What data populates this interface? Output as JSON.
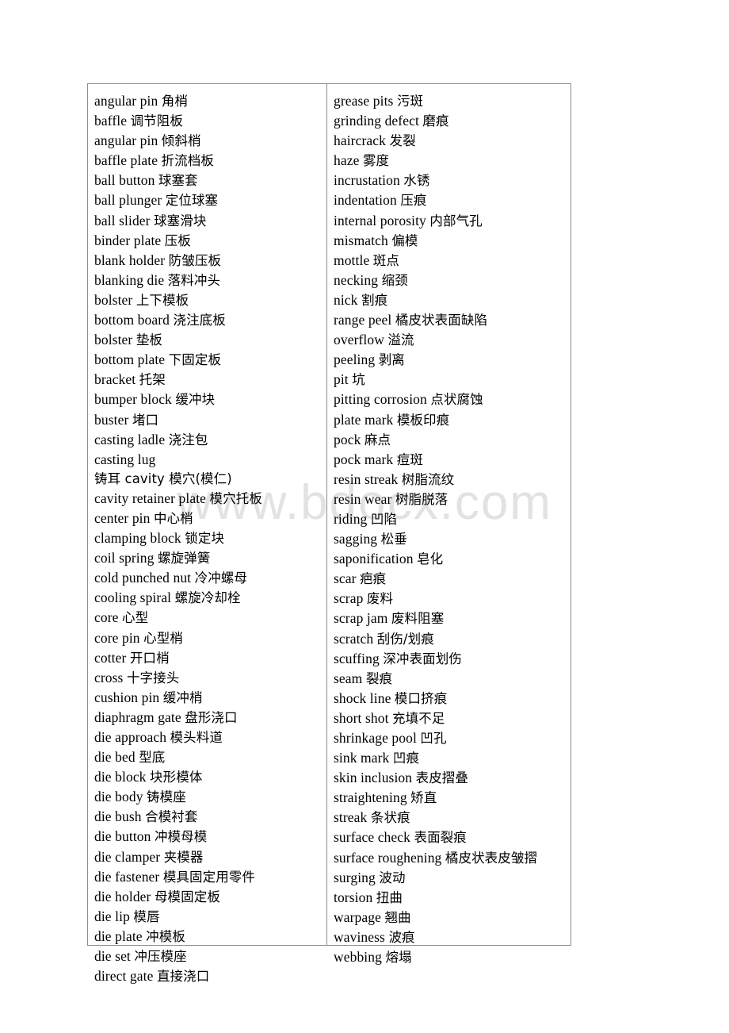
{
  "page": {
    "watermark_text": "www.bdocx.com",
    "background_color": "#ffffff",
    "border_color": "#8c8c8c",
    "text_color": "#000000",
    "watermark_color": "#e3e1e4"
  },
  "glossary": {
    "left_column": [
      "angular pin 角梢",
      "baffle 调节阻板",
      "angular pin 倾斜梢",
      "baffle plate 折流档板",
      "ball button 球塞套",
      "ball plunger 定位球塞",
      "ball slider 球塞滑块",
      "binder plate 压板",
      "blank holder 防皱压板",
      "blanking die 落料冲头",
      "bolster 上下模板",
      "bottom board 浇注底板",
      "bolster 垫板",
      "bottom plate 下固定板",
      "bracket 托架",
      "bumper block 缓冲块",
      "buster 堵口",
      "casting ladle 浇注包",
      "casting lug",
      "铸耳 cavity 模穴(模仁)",
      "cavity retainer plate 模穴托板",
      "center pin 中心梢",
      "clamping block 锁定块",
      "coil spring 螺旋弹簧",
      "cold punched nut 冷冲螺母",
      "cooling spiral 螺旋冷却栓",
      "core 心型",
      "core pin 心型梢",
      "cotter 开口梢",
      "cross 十字接头",
      "cushion pin 缓冲梢",
      "diaphragm gate 盘形浇口",
      "die approach 模头料道",
      "die bed 型底",
      "die block 块形模体",
      "die body 铸模座",
      "die bush 合模衬套",
      "die button 冲模母模",
      "die clamper 夹模器",
      "die fastener 模具固定用零件",
      "die holder 母模固定板",
      "die lip 模唇",
      "die plate 冲模板",
      "die set 冲压模座",
      "direct gate 直接浇口"
    ],
    "right_column": [
      "grease pits 污斑",
      "grinding defect 磨痕",
      "haircrack 发裂",
      "haze 雾度",
      "incrustation 水锈",
      "indentation 压痕",
      "internal porosity 内部气孔",
      "mismatch 偏模",
      "mottle 斑点",
      "necking 缩颈",
      "nick 割痕",
      "range peel 橘皮状表面缺陷",
      "overflow 溢流",
      "peeling 剥离",
      "pit 坑",
      "pitting corrosion 点状腐蚀",
      "plate mark 模板印痕",
      "pock 麻点",
      "pock mark 痘斑",
      "resin streak 树脂流纹",
      "resin wear 树脂脱落",
      "riding 凹陷",
      "sagging 松垂",
      "saponification 皂化",
      "scar 疤痕",
      "scrap 废料",
      "scrap jam 废料阻塞",
      "scratch 刮伤/划痕",
      "scuffing 深冲表面划伤",
      "seam 裂痕",
      "shock line 模口挤痕",
      "short shot 充填不足",
      "shrinkage pool 凹孔",
      "sink mark 凹痕",
      "skin inclusion 表皮摺叠",
      "straightening 矫直",
      "streak 条状痕",
      "surface check 表面裂痕",
      "surface roughening 橘皮状表皮皱摺",
      "surging 波动",
      "torsion 扭曲",
      "warpage 翘曲",
      "waviness 波痕",
      "webbing 熔塌"
    ]
  }
}
